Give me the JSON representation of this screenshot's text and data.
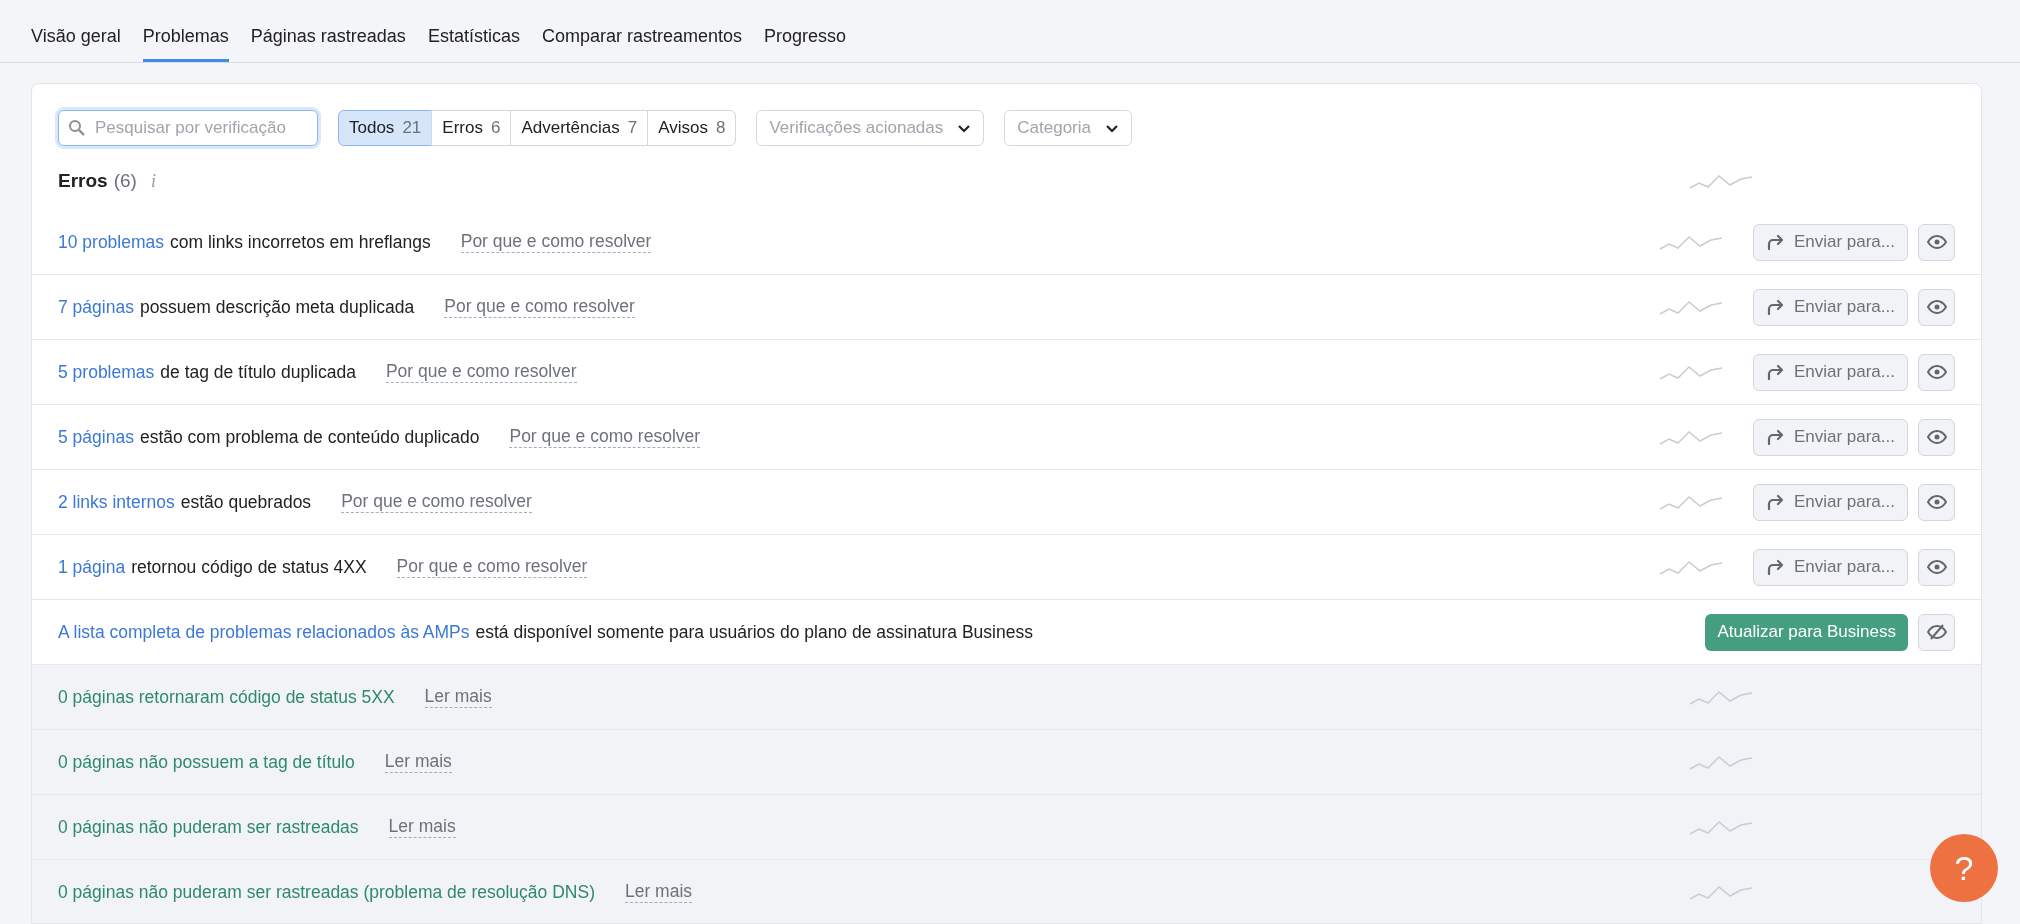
{
  "tabs": [
    {
      "label": "Visão geral",
      "selected": false
    },
    {
      "label": "Problemas",
      "selected": true
    },
    {
      "label": "Páginas rastreadas",
      "selected": false
    },
    {
      "label": "Estatísticas",
      "selected": false
    },
    {
      "label": "Comparar rastreamentos",
      "selected": false
    },
    {
      "label": "Progresso",
      "selected": false
    }
  ],
  "search": {
    "placeholder": "Pesquisar por verificação"
  },
  "filters": [
    {
      "label": "Todos",
      "count": "21",
      "selected": true
    },
    {
      "label": "Erros",
      "count": "6",
      "selected": false
    },
    {
      "label": "Advertências",
      "count": "7",
      "selected": false
    },
    {
      "label": "Avisos",
      "count": "8",
      "selected": false
    }
  ],
  "dropdowns": [
    {
      "placeholder": "Verificações acionadas"
    },
    {
      "placeholder": "Categoria"
    }
  ],
  "section": {
    "title": "Erros",
    "count": "(6)",
    "info": "i"
  },
  "rows": [
    {
      "kind": "issue",
      "link": "10 problemas",
      "text": "com links incorretos em hreflangs",
      "help": "Por que e como resolver",
      "send": "Enviar para..."
    },
    {
      "kind": "issue",
      "link": "7 páginas",
      "text": "possuem descrição meta duplicada",
      "help": "Por que e como resolver",
      "send": "Enviar para..."
    },
    {
      "kind": "issue",
      "link": "5 problemas",
      "text": "de tag de título duplicada",
      "help": "Por que e como resolver",
      "send": "Enviar para..."
    },
    {
      "kind": "issue",
      "link": "5 páginas",
      "text": "estão com problema de conteúdo duplicado",
      "help": "Por que e como resolver",
      "send": "Enviar para..."
    },
    {
      "kind": "issue",
      "link": "2 links internos",
      "text": "estão quebrados",
      "help": "Por que e como resolver",
      "send": "Enviar para..."
    },
    {
      "kind": "issue",
      "link": "1 página",
      "text": "retornou código de status 4XX",
      "help": "Por que e como resolver",
      "send": "Enviar para..."
    },
    {
      "kind": "upsell",
      "link": "A lista completa de problemas relacionados às AMPs",
      "text": "está disponível somente para usuários do plano de assinatura Business",
      "button": "Atualizar para Business"
    },
    {
      "kind": "passed",
      "text": "0 páginas retornaram código de status 5XX",
      "help": "Ler mais"
    },
    {
      "kind": "passed",
      "text": "0 páginas não possuem a tag de título",
      "help": "Ler mais"
    },
    {
      "kind": "passed",
      "text": "0 páginas não puderam ser rastreadas",
      "help": "Ler mais"
    },
    {
      "kind": "passed",
      "text": "0 páginas não puderam ser rastreadas (problema de resolução DNS)",
      "help": "Ler mais"
    }
  ],
  "help_button": "?"
}
